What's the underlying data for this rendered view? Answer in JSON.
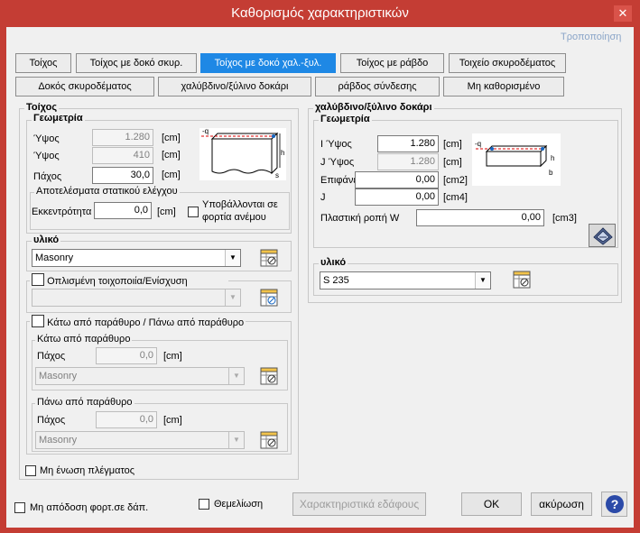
{
  "window": {
    "title": "Καθορισμός χαρακτηριστικών"
  },
  "header": {
    "modify_link": "Τροποποίηση"
  },
  "tabs_row1": [
    "Τοίχος",
    "Τοίχος με δοκό σκυρ.",
    "Τοίχος με δοκό χαλ.-ξυλ.",
    "Τοίχος με ράβδο",
    "Τοιχείο σκυροδέματος"
  ],
  "tabs_row2": [
    "Δοκός σκυροδέματος",
    "χαλύβδινο/ξύλινο δοκάρι",
    "ράβδος σύνδεσης",
    "Μη καθορισμένο"
  ],
  "wall": {
    "section_title": "Τοίχος",
    "geometry_title": "Γεωμετρία",
    "height_label": "Ύψος",
    "height_value": "1.280",
    "height_unit": "[cm]",
    "height2_label": "Ύψος",
    "height2_value": "410",
    "height2_unit": "[cm]",
    "thickness_label": "Πάχος",
    "thickness_value": "30,0",
    "thickness_unit": "[cm]",
    "results_title": "Αποτελέσματα στατικού ελέγχου",
    "eccentricity_label": "Εκκεντρότητα",
    "eccentricity_value": "0,0",
    "eccentricity_unit": "[cm]",
    "wind_label_1": "Υποβάλλονται σε",
    "wind_label_2": "φορτία ανέμου",
    "material_title": "υλικό",
    "material_value": "Masonry",
    "reinforced_label": "Οπλισμένη τοιχοποιία/Ενίσχυση",
    "window_label": "Κάτω από παράθυρο / Πάνω από παράθυρο",
    "below_title": "Κάτω από παράθυρο",
    "below_thickness_label": "Πάχος",
    "below_thickness_value": "0,0",
    "below_unit": "[cm]",
    "below_material": "Masonry",
    "above_title": "Πάνω από παράθυρο",
    "above_thickness_label": "Πάχος",
    "above_thickness_value": "0,0",
    "above_unit": "[cm]",
    "above_material": "Masonry",
    "mesh_label": "Μη ένωση πλέγματος"
  },
  "beam": {
    "section_title": "χαλύβδινο/ξύλινο δοκάρι",
    "geometry_title": "Γεωμετρία",
    "i_height_label": "I Ύψος",
    "i_height_value": "1.280",
    "i_height_unit": "[cm]",
    "j_height_label": "J Ύψος",
    "j_height_value": "1.280",
    "j_height_unit": "[cm]",
    "area_label": "Επιφάνεια",
    "area_value": "0,00",
    "area_unit": "[cm2]",
    "j_label": "J",
    "j_value": "0,00",
    "j_unit": "[cm4]",
    "plastic_label": "Πλαστική ροπή W",
    "plastic_value": "0,00",
    "plastic_unit": "[cm3]",
    "material_title": "υλικό",
    "material_value": "S 235"
  },
  "footer": {
    "no_load_label": "Μη απόδοση φορτ.σε δάπ.",
    "foundation_label": "Θεμελίωση",
    "soil_button": "Χαρακτηριστικά εδάφους",
    "ok_button": "OK",
    "cancel_button": "ακύρωση",
    "help_icon": "?"
  },
  "colors": {
    "titlebar": "#c43d34",
    "active_tab": "#1e88e5",
    "link": "#8aa5c8"
  }
}
